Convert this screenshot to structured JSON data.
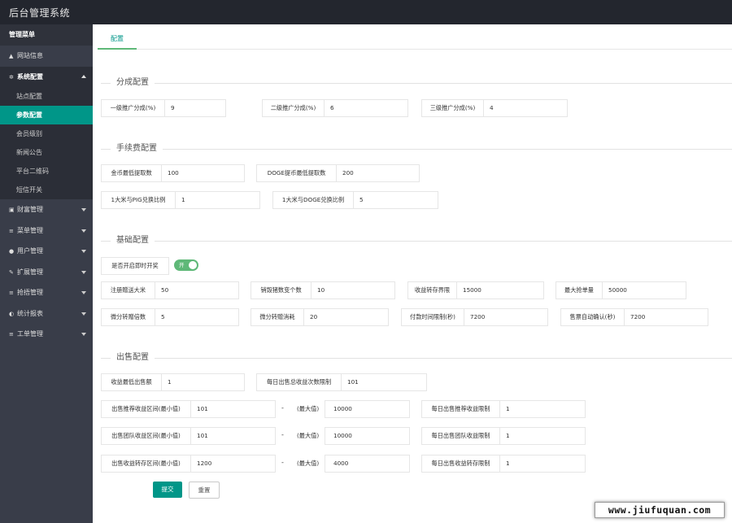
{
  "app": {
    "title": "后台管理系统"
  },
  "sidebar": {
    "header": "管理菜单",
    "top_items": [
      {
        "label": "网站信息",
        "icon": "home-icon",
        "glyph": "▲"
      }
    ],
    "open_group": {
      "label": "系统配置",
      "icon": "gears-icon",
      "glyph": "✲",
      "children": [
        {
          "label": "站点配置",
          "active": false
        },
        {
          "label": "参数配置",
          "active": true
        },
        {
          "label": "会员级别",
          "active": false
        },
        {
          "label": "新闻公告",
          "active": false
        },
        {
          "label": "平台二维码",
          "active": false
        },
        {
          "label": "短信开关",
          "active": false
        }
      ]
    },
    "groups": [
      {
        "label": "财富管理",
        "icon": "money-icon",
        "glyph": "▣"
      },
      {
        "label": "菜单管理",
        "icon": "list-icon",
        "glyph": "≡"
      },
      {
        "label": "用户管理",
        "icon": "user-icon",
        "glyph": "●"
      },
      {
        "label": "扩展管理",
        "icon": "wrench-icon",
        "glyph": "✎"
      },
      {
        "label": "抢捂管理",
        "icon": "list-icon",
        "glyph": "≡"
      },
      {
        "label": "统计报表",
        "icon": "dashboard-icon",
        "glyph": "◐"
      },
      {
        "label": "工单管理",
        "icon": "list-icon",
        "glyph": "≡"
      }
    ]
  },
  "tabs": [
    {
      "label": "配置",
      "active": true
    }
  ],
  "sections": {
    "commission": {
      "title": "分成配置",
      "fields": [
        {
          "label": "一级推广分成(%)",
          "value": "9"
        },
        {
          "label": "二级推广分成(%)",
          "value": "6"
        },
        {
          "label": "三级推广分成(%)",
          "value": "4"
        }
      ]
    },
    "fee": {
      "title": "手续费配置",
      "fields": [
        {
          "label": "金币最低提取数",
          "value": "100"
        },
        {
          "label": "DOGE提币最低提取数",
          "value": "200"
        },
        {
          "label": "1大米与PIG兑换比例",
          "value": "1"
        },
        {
          "label": "1大米与DOGE兑换比例",
          "value": "5"
        }
      ]
    },
    "basic": {
      "title": "基础配置",
      "switch": {
        "label": "是否开启即时开奖",
        "text": "开",
        "on": true
      },
      "fields": [
        {
          "label": "注册赠送大米",
          "value": "50"
        },
        {
          "label": "销毁猪数变个数",
          "value": "10"
        },
        {
          "label": "收益转存界限",
          "value": "15000"
        },
        {
          "label": "最大抢单量",
          "value": "50000"
        },
        {
          "label": "微分转赠倍数",
          "value": "5"
        },
        {
          "label": "微分转赠消耗",
          "value": "20"
        },
        {
          "label": "付款时间限制(秒)",
          "value": "7200"
        },
        {
          "label": "售票自动确认(秒)",
          "value": "7200"
        }
      ]
    },
    "sale": {
      "title": "出售配置",
      "fields": [
        {
          "label": "收益最低出售额",
          "value": "1"
        },
        {
          "label": "每日出售总收益次数限制",
          "value": "101"
        }
      ],
      "dash": "-",
      "max_label": "(最大值)",
      "rows": [
        {
          "min_label": "出售推荐收益区间(最小值)",
          "min": "101",
          "max": "10000",
          "limit_label": "每日出售推荐收益限制",
          "limit": "1"
        },
        {
          "min_label": "出售团队收益区间(最小值)",
          "min": "101",
          "max": "10000",
          "limit_label": "每日出售团队收益限制",
          "limit": "1"
        },
        {
          "min_label": "出售收益转存区间(最小值)",
          "min": "1200",
          "max": "4000",
          "limit_label": "每日出售收益转存限制",
          "limit": "1"
        }
      ]
    }
  },
  "buttons": {
    "submit": "提交",
    "reset": "重置"
  },
  "watermark": "www.jiufuquan.com",
  "colors": {
    "topbar": "#23262e",
    "sidebar": "#393d49",
    "accent": "#009688",
    "switch": "#5fb878"
  }
}
